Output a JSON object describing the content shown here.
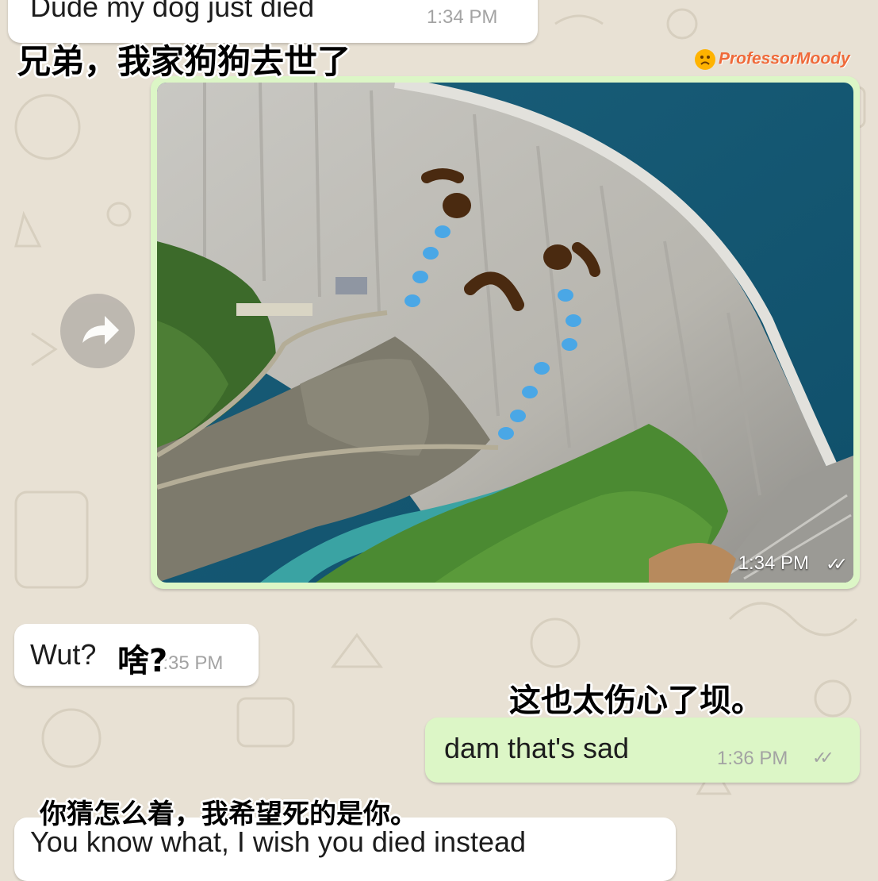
{
  "messages": {
    "m1": {
      "text": "Dude my dog just died",
      "time": "1:34 PM"
    },
    "image_msg": {
      "time": "1:34 PM",
      "ticks": "✓✓"
    },
    "m2": {
      "text": "Wut?",
      "time": "1:35 PM"
    },
    "m3": {
      "text": "dam that's sad",
      "time": "1:36 PM",
      "ticks": "✓✓"
    },
    "m4": {
      "text": "You know what, I wish you died instead"
    }
  },
  "captions": {
    "c1": "兄弟，我家狗狗去世了",
    "c2": "啥?",
    "c3": "这也太伤心了坝。",
    "c4": "你猜怎么着，我希望死的是你。"
  },
  "watermark": "ProfessorMoody",
  "icons": {
    "forward": "forward-arrow-icon",
    "read_receipt": "double-check-icon"
  },
  "colors": {
    "incoming_bubble": "#ffffff",
    "outgoing_bubble": "#dcf6c6",
    "wallpaper": "#e8e1d4",
    "watermark": "#ef6a3a"
  }
}
